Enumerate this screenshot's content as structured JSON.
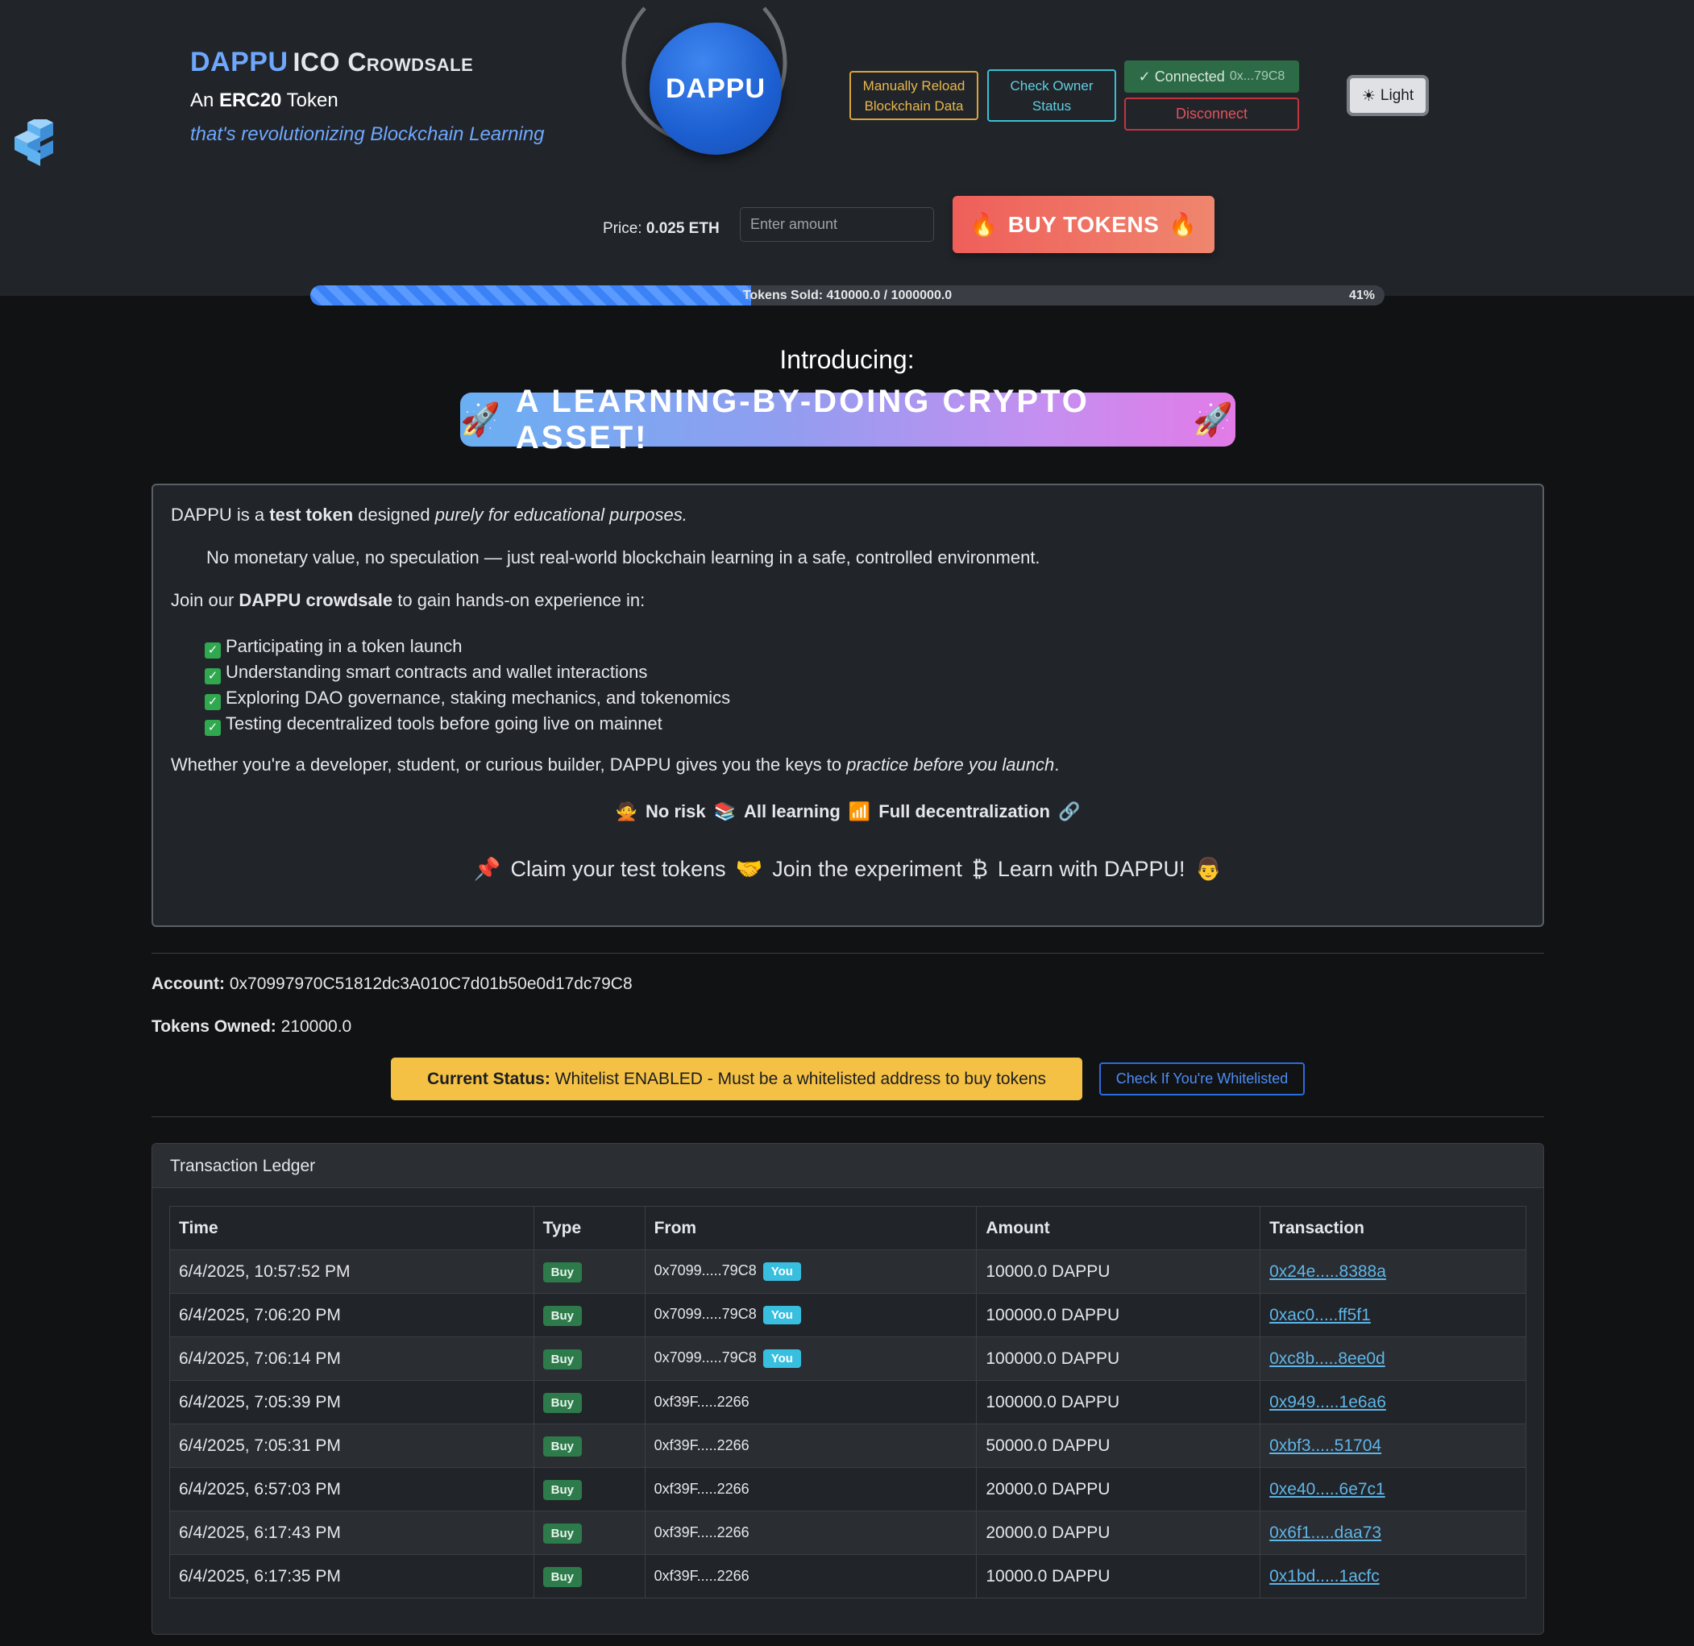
{
  "header": {
    "brand_name": "DAPPU",
    "brand_suffix": "ICO Crowdsale",
    "subtitle_pre": "An ",
    "subtitle_bold": "ERC20",
    "subtitle_post": " Token",
    "tagline": "that's revolutionizing Blockchain Learning",
    "logo_text": "DAPPU",
    "reload_label_1": "Manually Reload",
    "reload_label_2": "Blockchain Data",
    "owner_label_1": "Check Owner",
    "owner_label_2": "Status",
    "connected_label": "✓ Connected",
    "connected_addr": "0x...79C8",
    "disconnect_label": "Disconnect",
    "theme_icon": "sun-icon",
    "theme_label": "Light"
  },
  "purchase": {
    "price_label": "Price:",
    "price_value": "0.025 ETH",
    "amount_placeholder": "Enter amount",
    "buy_label": "BUY TOKENS",
    "buy_icon": "fire-icon"
  },
  "progress": {
    "label": "Tokens Sold: 410000.0 / 1000000.0",
    "percent_label": "41%",
    "fraction": 0.41,
    "fill_color": "#3b82f6"
  },
  "intro": {
    "heading": "Introducing:",
    "banner": "A LEARNING-BY-DOING CRYPTO ASSET!",
    "banner_icon": "rocket-icon"
  },
  "about": {
    "p1_a": "DAPPU is a ",
    "p1_b": "test token",
    "p1_c": " designed ",
    "p1_d": "purely for educational purposes.",
    "p2": "No monetary value, no speculation — just real-world blockchain learning in a safe, controlled environment.",
    "p3_a": "Join our ",
    "p3_b": "DAPPU crowdsale",
    "p3_c": " to gain hands-on experience in:",
    "items": [
      "Participating in a token launch",
      "Understanding smart contracts and wallet interactions",
      "Exploring DAO governance, staking mechanics, and tokenomics",
      "Testing decentralized tools before going live on mainnet"
    ],
    "p4_a": "Whether you're a developer, student, or curious builder, DAPPU gives you the keys to ",
    "p4_b": "practice before you launch",
    "p4_c": ".",
    "perk_1": "No risk",
    "perk_2": "All learning",
    "perk_3": "Full decentralization",
    "cta_1": "Claim your test tokens",
    "cta_2": "Join the experiment",
    "cta_3": "Learn with DAPPU!"
  },
  "account": {
    "account_label": "Account:",
    "account_value": "0x70997970C51812dc3A010C7d01b50e0d17dc79C8",
    "owned_label": "Tokens Owned:",
    "owned_value": "210000.0"
  },
  "status": {
    "label": "Current Status:",
    "text": "Whitelist ENABLED - Must be a whitelisted address to buy tokens",
    "check_label": "Check If You're Whitelisted"
  },
  "ledger": {
    "title": "Transaction Ledger",
    "columns": [
      "Time",
      "Type",
      "From",
      "Amount",
      "Transaction"
    ],
    "rows": [
      {
        "time": "6/4/2025, 10:57:52 PM",
        "type": "Buy",
        "from": "0x7099.....79C8",
        "you": "You",
        "amount": "10000.0 DAPPU",
        "tx": "0x24e.....8388a"
      },
      {
        "time": "6/4/2025, 7:06:20 PM",
        "type": "Buy",
        "from": "0x7099.....79C8",
        "you": "You",
        "amount": "100000.0 DAPPU",
        "tx": "0xac0.....ff5f1"
      },
      {
        "time": "6/4/2025, 7:06:14 PM",
        "type": "Buy",
        "from": "0x7099.....79C8",
        "you": "You",
        "amount": "100000.0 DAPPU",
        "tx": "0xc8b.....8ee0d"
      },
      {
        "time": "6/4/2025, 7:05:39 PM",
        "type": "Buy",
        "from": "0xf39F.....2266",
        "you": "",
        "amount": "100000.0 DAPPU",
        "tx": "0x949.....1e6a6"
      },
      {
        "time": "6/4/2025, 7:05:31 PM",
        "type": "Buy",
        "from": "0xf39F.....2266",
        "you": "",
        "amount": "50000.0 DAPPU",
        "tx": "0xbf3.....51704"
      },
      {
        "time": "6/4/2025, 6:57:03 PM",
        "type": "Buy",
        "from": "0xf39F.....2266",
        "you": "",
        "amount": "20000.0 DAPPU",
        "tx": "0xe40.....6e7c1"
      },
      {
        "time": "6/4/2025, 6:17:43 PM",
        "type": "Buy",
        "from": "0xf39F.....2266",
        "you": "",
        "amount": "20000.0 DAPPU",
        "tx": "0x6f1.....daa73"
      },
      {
        "time": "6/4/2025, 6:17:35 PM",
        "type": "Buy",
        "from": "0xf39F.....2266",
        "you": "",
        "amount": "10000.0 DAPPU",
        "tx": "0x1bd.....1acfc"
      }
    ]
  }
}
